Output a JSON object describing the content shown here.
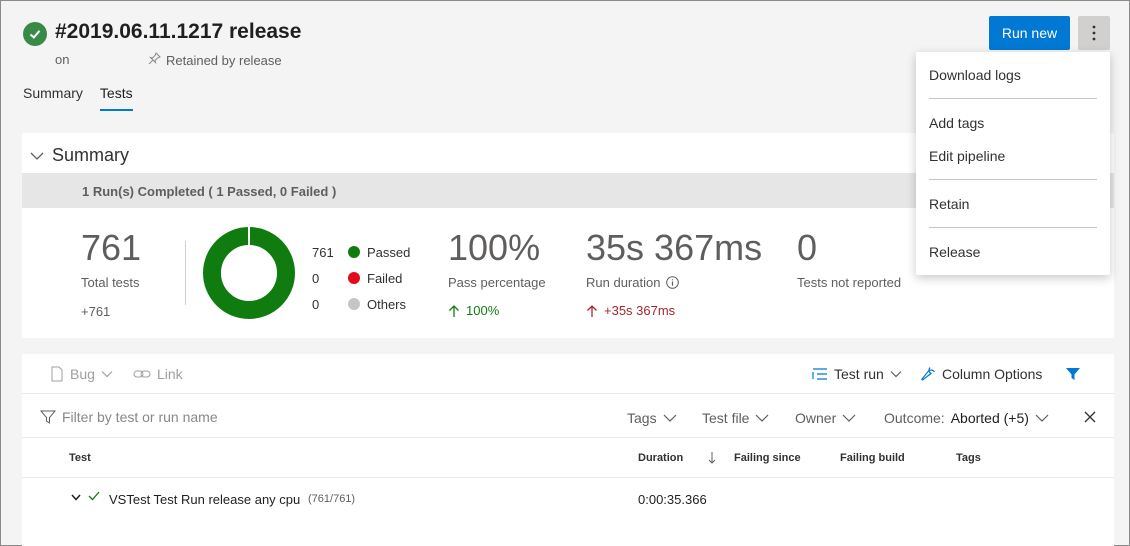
{
  "header": {
    "title": "#2019.06.11.1217 release",
    "subline": "on",
    "retained": "Retained by release",
    "run_new": "Run new"
  },
  "tabs": [
    {
      "label": "Summary",
      "active": false
    },
    {
      "label": "Tests",
      "active": true
    }
  ],
  "menu": {
    "items": [
      "Download logs",
      "Add tags",
      "Edit pipeline",
      "Retain",
      "Release"
    ]
  },
  "summary": {
    "heading": "Summary",
    "banner": "1 Run(s) Completed ( 1 Passed, 0 Failed )",
    "total_tests": "761",
    "total_label": "Total tests",
    "total_delta": "+761",
    "legend": [
      {
        "count": "761",
        "label": "Passed",
        "color": "#107c10"
      },
      {
        "count": "0",
        "label": "Failed",
        "color": "#e00b1c"
      },
      {
        "count": "0",
        "label": "Others",
        "color": "#c8c6c4"
      }
    ],
    "pass_pct": "100%",
    "pass_label": "Pass percentage",
    "pass_delta": "100%",
    "duration": "35s 367ms",
    "duration_label": "Run duration",
    "duration_delta": "+35s 367ms",
    "not_reported": "0",
    "not_reported_label": "Tests not reported"
  },
  "toolbar": {
    "bug": "Bug",
    "link": "Link",
    "test_run": "Test run",
    "column_options": "Column Options"
  },
  "filterbar": {
    "placeholder": "Filter by test or run name",
    "tags": "Tags",
    "test_file": "Test file",
    "owner": "Owner",
    "outcome_label": "Outcome:",
    "outcome_value": "Aborted (+5)"
  },
  "columns": [
    "Test",
    "Duration",
    "Failing since",
    "Failing build",
    "Tags"
  ],
  "rows": [
    {
      "name": "VSTest Test Run release any cpu",
      "count": "(761/761)",
      "duration": "0:00:35.366"
    }
  ],
  "colors": {
    "accent": "#0078d4",
    "passed": "#107c10",
    "failed": "#e00b1c",
    "delta_up_bad": "#a4262c"
  }
}
